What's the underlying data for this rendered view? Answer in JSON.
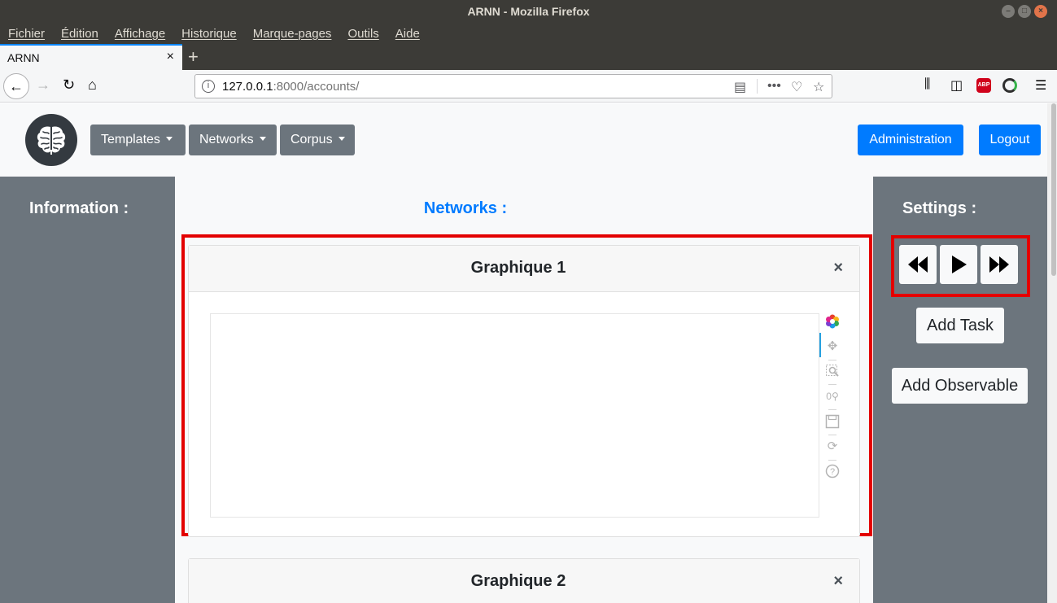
{
  "window": {
    "title": "ARNN - Mozilla Firefox"
  },
  "menu": [
    "Fichier",
    "Édition",
    "Affichage",
    "Historique",
    "Marque-pages",
    "Outils",
    "Aide"
  ],
  "tab": {
    "title": "ARNN",
    "close": "×",
    "new": "+"
  },
  "url": {
    "host": "127.0.0.1",
    "rest": ":8000/accounts/"
  },
  "toolbar_icons": [
    "library-icon",
    "sidebar-icon",
    "adblock-icon",
    "extension-icon",
    "menu-icon"
  ],
  "abp_label": "ABP",
  "nav": {
    "buttons": [
      "Templates",
      "Networks",
      "Corpus"
    ],
    "admin": "Administration",
    "logout": "Logout"
  },
  "left": {
    "heading": "Information :"
  },
  "center": {
    "heading": "Networks :",
    "cards": [
      {
        "title": "Graphique 1",
        "close": "×"
      },
      {
        "title": "Graphique 2",
        "close": "×"
      }
    ]
  },
  "right": {
    "heading": "Settings :",
    "add_task": "Add Task",
    "add_observable": "Add Observable"
  },
  "plot_tools": [
    "plotly-logo-icon",
    "pan-icon",
    "box-zoom-icon",
    "wheel-zoom-icon",
    "save-icon",
    "reset-icon",
    "help-icon"
  ],
  "colors": {
    "accent": "#007bff",
    "panel": "#6c757d",
    "highlight": "#e30000"
  }
}
